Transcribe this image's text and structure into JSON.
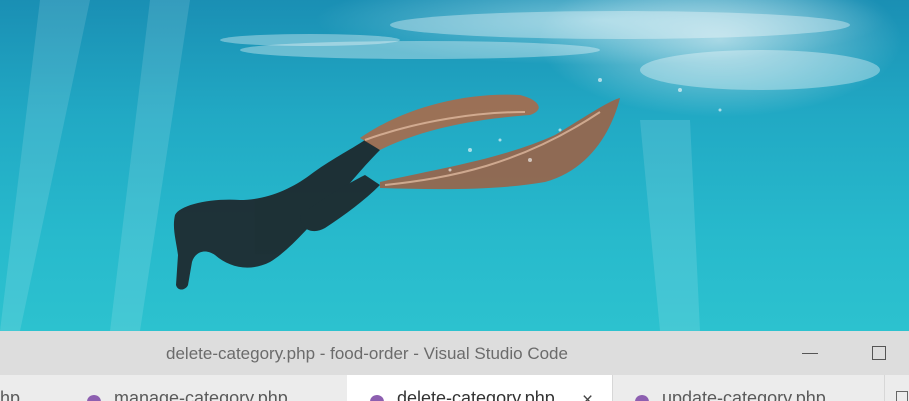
{
  "window": {
    "title": "delete-category.php - food-order - Visual Studio Code"
  },
  "tabs": {
    "left_partial_label": "hp",
    "items": [
      {
        "label": "manage-category.php",
        "active": false,
        "icon": "php-elephant-icon"
      },
      {
        "label": "delete-category.php",
        "active": true,
        "icon": "php-elephant-icon",
        "close": "×"
      },
      {
        "label": "update-category.php",
        "active": false,
        "icon": "php-elephant-icon"
      }
    ]
  },
  "colors": {
    "titlebar_bg": "#dddddd",
    "tabbar_bg": "#ececec",
    "active_tab_bg": "#ffffff",
    "php_icon": "#8d5fb0",
    "water": "#21a9c4"
  }
}
